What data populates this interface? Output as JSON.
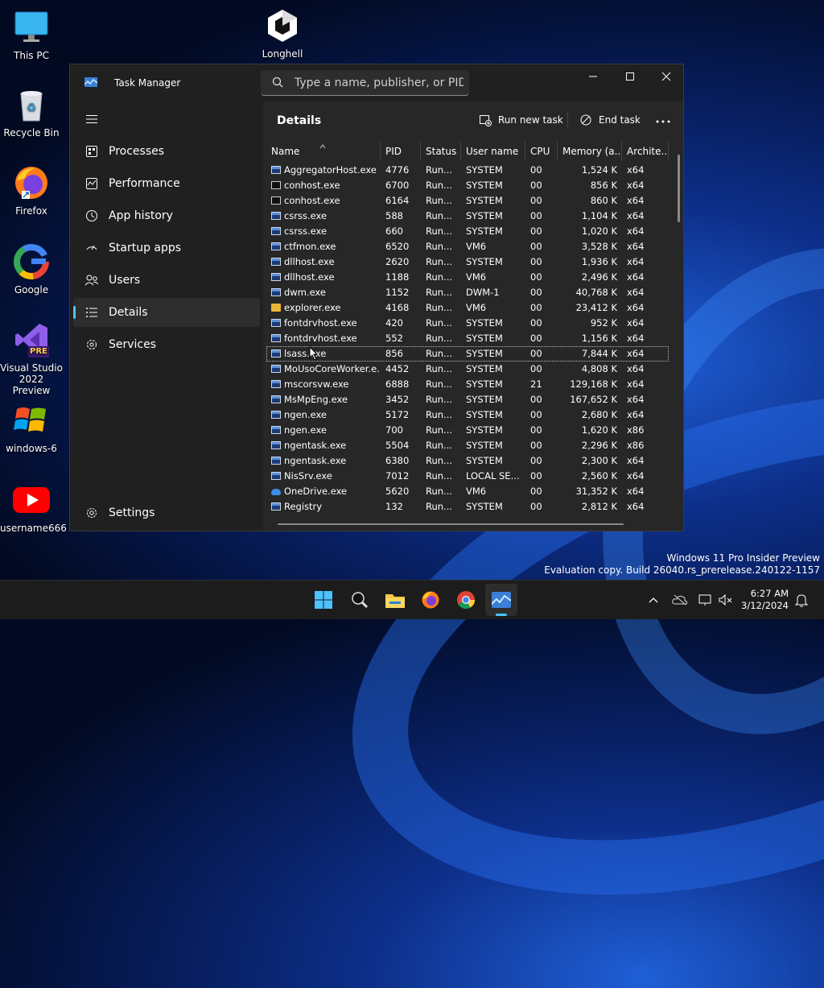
{
  "desktop": {
    "icons": [
      {
        "label": "This PC",
        "name": "this-pc-icon"
      },
      {
        "label": "Longhell",
        "name": "unity-icon"
      },
      {
        "label": "Recycle Bin",
        "name": "recycle-bin-icon"
      },
      {
        "label": "Firefox",
        "name": "firefox-icon"
      },
      {
        "label": "Google",
        "name": "google-icon"
      },
      {
        "label": "Visual Studio 2022 Preview",
        "name": "visual-studio-icon",
        "badge": "PRE"
      },
      {
        "label": "windows-6",
        "name": "windows-logo-icon"
      },
      {
        "label": "username666",
        "name": "youtube-icon"
      }
    ]
  },
  "window": {
    "title": "Task Manager",
    "search_placeholder": "Type a name, publisher, or PID...",
    "accent": "#4cc2ff"
  },
  "nav": {
    "items": [
      {
        "label": "Processes",
        "icon": "processes-icon"
      },
      {
        "label": "Performance",
        "icon": "performance-icon"
      },
      {
        "label": "App history",
        "icon": "history-icon"
      },
      {
        "label": "Startup apps",
        "icon": "startup-icon"
      },
      {
        "label": "Users",
        "icon": "users-icon"
      },
      {
        "label": "Details",
        "icon": "details-icon",
        "active": true
      },
      {
        "label": "Services",
        "icon": "services-icon"
      }
    ],
    "settings": "Settings"
  },
  "details": {
    "title": "Details",
    "run_new_task": "Run new task",
    "end_task": "End task",
    "columns": [
      "Name",
      "PID",
      "Status",
      "User name",
      "CPU",
      "Memory (a...",
      "Archite..."
    ],
    "rows": [
      {
        "name": "AggregatorHost.exe",
        "pid": "4776",
        "status": "Run...",
        "user": "SYSTEM",
        "cpu": "00",
        "mem": "1,524 K",
        "arch": "x64",
        "icon": "exe"
      },
      {
        "name": "conhost.exe",
        "pid": "6700",
        "status": "Run...",
        "user": "SYSTEM",
        "cpu": "00",
        "mem": "856 K",
        "arch": "x64",
        "icon": "cmd"
      },
      {
        "name": "conhost.exe",
        "pid": "6164",
        "status": "Run...",
        "user": "SYSTEM",
        "cpu": "00",
        "mem": "860 K",
        "arch": "x64",
        "icon": "cmd"
      },
      {
        "name": "csrss.exe",
        "pid": "588",
        "status": "Run...",
        "user": "SYSTEM",
        "cpu": "00",
        "mem": "1,104 K",
        "arch": "x64",
        "icon": "exe"
      },
      {
        "name": "csrss.exe",
        "pid": "660",
        "status": "Run...",
        "user": "SYSTEM",
        "cpu": "00",
        "mem": "1,020 K",
        "arch": "x64",
        "icon": "exe"
      },
      {
        "name": "ctfmon.exe",
        "pid": "6520",
        "status": "Run...",
        "user": "VM6",
        "cpu": "00",
        "mem": "3,528 K",
        "arch": "x64",
        "icon": "exe"
      },
      {
        "name": "dllhost.exe",
        "pid": "2620",
        "status": "Run...",
        "user": "SYSTEM",
        "cpu": "00",
        "mem": "1,936 K",
        "arch": "x64",
        "icon": "exe"
      },
      {
        "name": "dllhost.exe",
        "pid": "1188",
        "status": "Run...",
        "user": "VM6",
        "cpu": "00",
        "mem": "2,496 K",
        "arch": "x64",
        "icon": "exe"
      },
      {
        "name": "dwm.exe",
        "pid": "1152",
        "status": "Run...",
        "user": "DWM-1",
        "cpu": "00",
        "mem": "40,768 K",
        "arch": "x64",
        "icon": "exe"
      },
      {
        "name": "explorer.exe",
        "pid": "4168",
        "status": "Run...",
        "user": "VM6",
        "cpu": "00",
        "mem": "23,412 K",
        "arch": "x64",
        "icon": "folder"
      },
      {
        "name": "fontdrvhost.exe",
        "pid": "420",
        "status": "Run...",
        "user": "SYSTEM",
        "cpu": "00",
        "mem": "952 K",
        "arch": "x64",
        "icon": "exe"
      },
      {
        "name": "fontdrvhost.exe",
        "pid": "552",
        "status": "Run...",
        "user": "SYSTEM",
        "cpu": "00",
        "mem": "1,156 K",
        "arch": "x64",
        "icon": "exe"
      },
      {
        "name": "lsass.exe",
        "pid": "856",
        "status": "Run...",
        "user": "SYSTEM",
        "cpu": "00",
        "mem": "7,844 K",
        "arch": "x64",
        "icon": "exe",
        "selected": true
      },
      {
        "name": "MoUsoCoreWorker.e...",
        "pid": "4452",
        "status": "Run...",
        "user": "SYSTEM",
        "cpu": "00",
        "mem": "4,808 K",
        "arch": "x64",
        "icon": "exe"
      },
      {
        "name": "mscorsvw.exe",
        "pid": "6888",
        "status": "Run...",
        "user": "SYSTEM",
        "cpu": "21",
        "mem": "129,168 K",
        "arch": "x64",
        "icon": "exe"
      },
      {
        "name": "MsMpEng.exe",
        "pid": "3452",
        "status": "Run...",
        "user": "SYSTEM",
        "cpu": "00",
        "mem": "167,652 K",
        "arch": "x64",
        "icon": "exe"
      },
      {
        "name": "ngen.exe",
        "pid": "5172",
        "status": "Run...",
        "user": "SYSTEM",
        "cpu": "00",
        "mem": "2,680 K",
        "arch": "x64",
        "icon": "exe"
      },
      {
        "name": "ngen.exe",
        "pid": "700",
        "status": "Run...",
        "user": "SYSTEM",
        "cpu": "00",
        "mem": "1,620 K",
        "arch": "x86",
        "icon": "exe"
      },
      {
        "name": "ngentask.exe",
        "pid": "5504",
        "status": "Run...",
        "user": "SYSTEM",
        "cpu": "00",
        "mem": "2,296 K",
        "arch": "x86",
        "icon": "exe"
      },
      {
        "name": "ngentask.exe",
        "pid": "6380",
        "status": "Run...",
        "user": "SYSTEM",
        "cpu": "00",
        "mem": "2,300 K",
        "arch": "x64",
        "icon": "exe"
      },
      {
        "name": "NisSrv.exe",
        "pid": "7012",
        "status": "Run...",
        "user": "LOCAL SE...",
        "cpu": "00",
        "mem": "2,560 K",
        "arch": "x64",
        "icon": "exe"
      },
      {
        "name": "OneDrive.exe",
        "pid": "5620",
        "status": "Run...",
        "user": "VM6",
        "cpu": "00",
        "mem": "31,352 K",
        "arch": "x64",
        "icon": "cloud"
      },
      {
        "name": "Registry",
        "pid": "132",
        "status": "Run...",
        "user": "SYSTEM",
        "cpu": "00",
        "mem": "2,812 K",
        "arch": "x64",
        "icon": "exe"
      }
    ]
  },
  "watermark": {
    "line1": "Windows 11 Pro Insider Preview",
    "line2": "Evaluation copy. Build 26040.rs_prerelease.240122-1157"
  },
  "taskbar": {
    "time": "6:27 AM",
    "date": "3/12/2024"
  }
}
